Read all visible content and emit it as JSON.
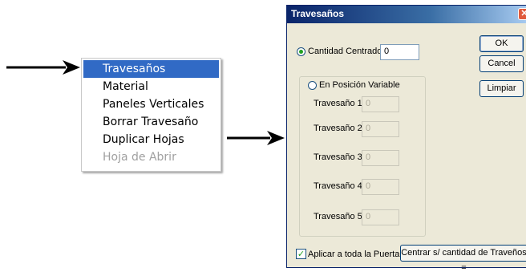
{
  "menu": {
    "items": [
      {
        "label": "Travesaños",
        "state": "selected"
      },
      {
        "label": "Material",
        "state": "normal"
      },
      {
        "label": "Paneles Verticales",
        "state": "normal"
      },
      {
        "label": "Borrar Travesaño",
        "state": "normal"
      },
      {
        "label": "Duplicar Hojas",
        "state": "normal"
      },
      {
        "label": "Hoja de Abrir",
        "state": "disabled"
      }
    ]
  },
  "dialog": {
    "title": "Travesaños",
    "close_glyph": "✕",
    "cantidad_centrados": {
      "label": "Cantidad Centrados :",
      "value": "0",
      "selected": true
    },
    "posicion_variable": {
      "label": "En Posición Variable",
      "selected": false
    },
    "travesanos": [
      {
        "label": "Travesaño 1 :",
        "value": "0"
      },
      {
        "label": "Travesaño 2 :",
        "value": "0"
      },
      {
        "label": "Travesaño 3 :",
        "value": "0"
      },
      {
        "label": "Travesaño 4 :",
        "value": "0"
      },
      {
        "label": "Travesaño 5 :",
        "value": "0"
      }
    ],
    "buttons": {
      "ok": "OK",
      "cancel": "Cancel",
      "clear": "Limpiar"
    },
    "apply_all": {
      "label": "Aplicar a toda la Puerta",
      "checked": true,
      "check_glyph": "✓"
    },
    "center_button": "Centrar s/ cantidad de Traveños ="
  },
  "colors": {
    "menu_highlight": "#316ac5",
    "dialog_bg": "#ece9d8",
    "titlebar": "#0a246a"
  }
}
